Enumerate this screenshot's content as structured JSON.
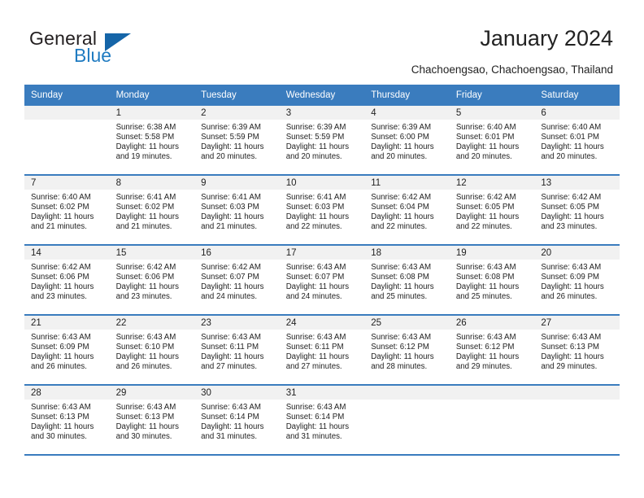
{
  "brand": {
    "name_top": "General",
    "name_bottom": "Blue",
    "color_dark": "#231f20",
    "color_blue": "#1f7bc1",
    "triangle_color": "#1565a8"
  },
  "header": {
    "title": "January 2024",
    "subtitle": "Chachoengsao, Chachoengsao, Thailand"
  },
  "theme": {
    "header_bg": "#3a7cbe",
    "header_text": "#ffffff",
    "daynum_band_bg": "#f1f1f1",
    "row_divider": "#3a7cbe"
  },
  "calendar": {
    "weekday_headers": [
      "Sunday",
      "Monday",
      "Tuesday",
      "Wednesday",
      "Thursday",
      "Friday",
      "Saturday"
    ],
    "weeks": [
      [
        {
          "day": "",
          "lines": []
        },
        {
          "day": "1",
          "lines": [
            "Sunrise: 6:38 AM",
            "Sunset: 5:58 PM",
            "Daylight: 11 hours",
            "and 19 minutes."
          ]
        },
        {
          "day": "2",
          "lines": [
            "Sunrise: 6:39 AM",
            "Sunset: 5:59 PM",
            "Daylight: 11 hours",
            "and 20 minutes."
          ]
        },
        {
          "day": "3",
          "lines": [
            "Sunrise: 6:39 AM",
            "Sunset: 5:59 PM",
            "Daylight: 11 hours",
            "and 20 minutes."
          ]
        },
        {
          "day": "4",
          "lines": [
            "Sunrise: 6:39 AM",
            "Sunset: 6:00 PM",
            "Daylight: 11 hours",
            "and 20 minutes."
          ]
        },
        {
          "day": "5",
          "lines": [
            "Sunrise: 6:40 AM",
            "Sunset: 6:01 PM",
            "Daylight: 11 hours",
            "and 20 minutes."
          ]
        },
        {
          "day": "6",
          "lines": [
            "Sunrise: 6:40 AM",
            "Sunset: 6:01 PM",
            "Daylight: 11 hours",
            "and 20 minutes."
          ]
        }
      ],
      [
        {
          "day": "7",
          "lines": [
            "Sunrise: 6:40 AM",
            "Sunset: 6:02 PM",
            "Daylight: 11 hours",
            "and 21 minutes."
          ]
        },
        {
          "day": "8",
          "lines": [
            "Sunrise: 6:41 AM",
            "Sunset: 6:02 PM",
            "Daylight: 11 hours",
            "and 21 minutes."
          ]
        },
        {
          "day": "9",
          "lines": [
            "Sunrise: 6:41 AM",
            "Sunset: 6:03 PM",
            "Daylight: 11 hours",
            "and 21 minutes."
          ]
        },
        {
          "day": "10",
          "lines": [
            "Sunrise: 6:41 AM",
            "Sunset: 6:03 PM",
            "Daylight: 11 hours",
            "and 22 minutes."
          ]
        },
        {
          "day": "11",
          "lines": [
            "Sunrise: 6:42 AM",
            "Sunset: 6:04 PM",
            "Daylight: 11 hours",
            "and 22 minutes."
          ]
        },
        {
          "day": "12",
          "lines": [
            "Sunrise: 6:42 AM",
            "Sunset: 6:05 PM",
            "Daylight: 11 hours",
            "and 22 minutes."
          ]
        },
        {
          "day": "13",
          "lines": [
            "Sunrise: 6:42 AM",
            "Sunset: 6:05 PM",
            "Daylight: 11 hours",
            "and 23 minutes."
          ]
        }
      ],
      [
        {
          "day": "14",
          "lines": [
            "Sunrise: 6:42 AM",
            "Sunset: 6:06 PM",
            "Daylight: 11 hours",
            "and 23 minutes."
          ]
        },
        {
          "day": "15",
          "lines": [
            "Sunrise: 6:42 AM",
            "Sunset: 6:06 PM",
            "Daylight: 11 hours",
            "and 23 minutes."
          ]
        },
        {
          "day": "16",
          "lines": [
            "Sunrise: 6:42 AM",
            "Sunset: 6:07 PM",
            "Daylight: 11 hours",
            "and 24 minutes."
          ]
        },
        {
          "day": "17",
          "lines": [
            "Sunrise: 6:43 AM",
            "Sunset: 6:07 PM",
            "Daylight: 11 hours",
            "and 24 minutes."
          ]
        },
        {
          "day": "18",
          "lines": [
            "Sunrise: 6:43 AM",
            "Sunset: 6:08 PM",
            "Daylight: 11 hours",
            "and 25 minutes."
          ]
        },
        {
          "day": "19",
          "lines": [
            "Sunrise: 6:43 AM",
            "Sunset: 6:08 PM",
            "Daylight: 11 hours",
            "and 25 minutes."
          ]
        },
        {
          "day": "20",
          "lines": [
            "Sunrise: 6:43 AM",
            "Sunset: 6:09 PM",
            "Daylight: 11 hours",
            "and 26 minutes."
          ]
        }
      ],
      [
        {
          "day": "21",
          "lines": [
            "Sunrise: 6:43 AM",
            "Sunset: 6:09 PM",
            "Daylight: 11 hours",
            "and 26 minutes."
          ]
        },
        {
          "day": "22",
          "lines": [
            "Sunrise: 6:43 AM",
            "Sunset: 6:10 PM",
            "Daylight: 11 hours",
            "and 26 minutes."
          ]
        },
        {
          "day": "23",
          "lines": [
            "Sunrise: 6:43 AM",
            "Sunset: 6:11 PM",
            "Daylight: 11 hours",
            "and 27 minutes."
          ]
        },
        {
          "day": "24",
          "lines": [
            "Sunrise: 6:43 AM",
            "Sunset: 6:11 PM",
            "Daylight: 11 hours",
            "and 27 minutes."
          ]
        },
        {
          "day": "25",
          "lines": [
            "Sunrise: 6:43 AM",
            "Sunset: 6:12 PM",
            "Daylight: 11 hours",
            "and 28 minutes."
          ]
        },
        {
          "day": "26",
          "lines": [
            "Sunrise: 6:43 AM",
            "Sunset: 6:12 PM",
            "Daylight: 11 hours",
            "and 29 minutes."
          ]
        },
        {
          "day": "27",
          "lines": [
            "Sunrise: 6:43 AM",
            "Sunset: 6:13 PM",
            "Daylight: 11 hours",
            "and 29 minutes."
          ]
        }
      ],
      [
        {
          "day": "28",
          "lines": [
            "Sunrise: 6:43 AM",
            "Sunset: 6:13 PM",
            "Daylight: 11 hours",
            "and 30 minutes."
          ]
        },
        {
          "day": "29",
          "lines": [
            "Sunrise: 6:43 AM",
            "Sunset: 6:13 PM",
            "Daylight: 11 hours",
            "and 30 minutes."
          ]
        },
        {
          "day": "30",
          "lines": [
            "Sunrise: 6:43 AM",
            "Sunset: 6:14 PM",
            "Daylight: 11 hours",
            "and 31 minutes."
          ]
        },
        {
          "day": "31",
          "lines": [
            "Sunrise: 6:43 AM",
            "Sunset: 6:14 PM",
            "Daylight: 11 hours",
            "and 31 minutes."
          ]
        },
        {
          "day": "",
          "lines": []
        },
        {
          "day": "",
          "lines": []
        },
        {
          "day": "",
          "lines": []
        }
      ]
    ]
  }
}
